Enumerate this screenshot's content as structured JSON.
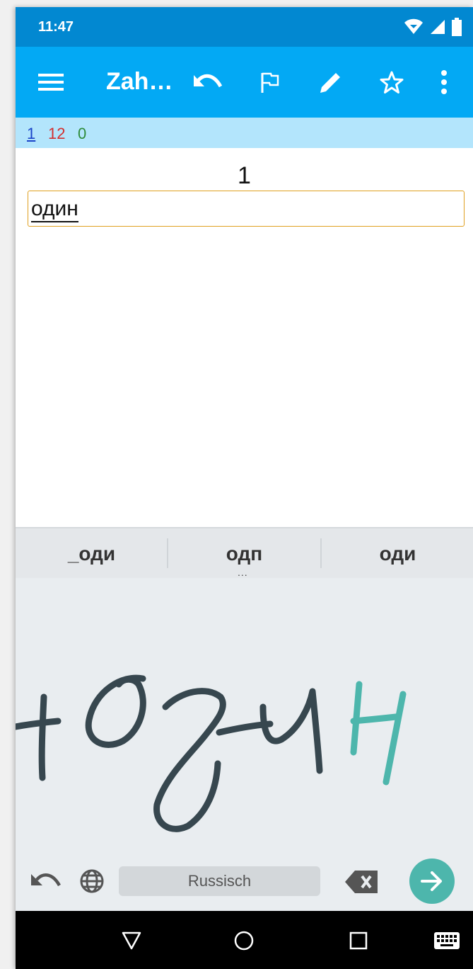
{
  "status_bar": {
    "time": "11:47",
    "icons": [
      "wifi-icon",
      "signal-icon",
      "battery-icon"
    ]
  },
  "app_bar": {
    "title": "Zah…",
    "icons": [
      "menu-icon",
      "undo-icon",
      "flag-icon",
      "edit-icon",
      "star-icon",
      "more-vert-icon"
    ]
  },
  "counters": {
    "blue": "1",
    "red": "12",
    "green": "0"
  },
  "content": {
    "question": "1",
    "answer": "один"
  },
  "keyboard": {
    "suggestions": [
      "_оди",
      "одп",
      "оди"
    ],
    "more_indicator": "...",
    "language": "Russisch",
    "handwriting": "одИН",
    "accent_color": "#4db6ac",
    "stroke_color": "#37474f"
  },
  "nav_bar": {
    "icons": [
      "back-icon",
      "home-icon",
      "recents-icon",
      "keyboard-icon"
    ]
  },
  "colors": {
    "status_bar": "#0288d1",
    "app_bar": "#03a9f4",
    "counter_bar": "#b3e5fc",
    "input_border": "#e0a020"
  }
}
